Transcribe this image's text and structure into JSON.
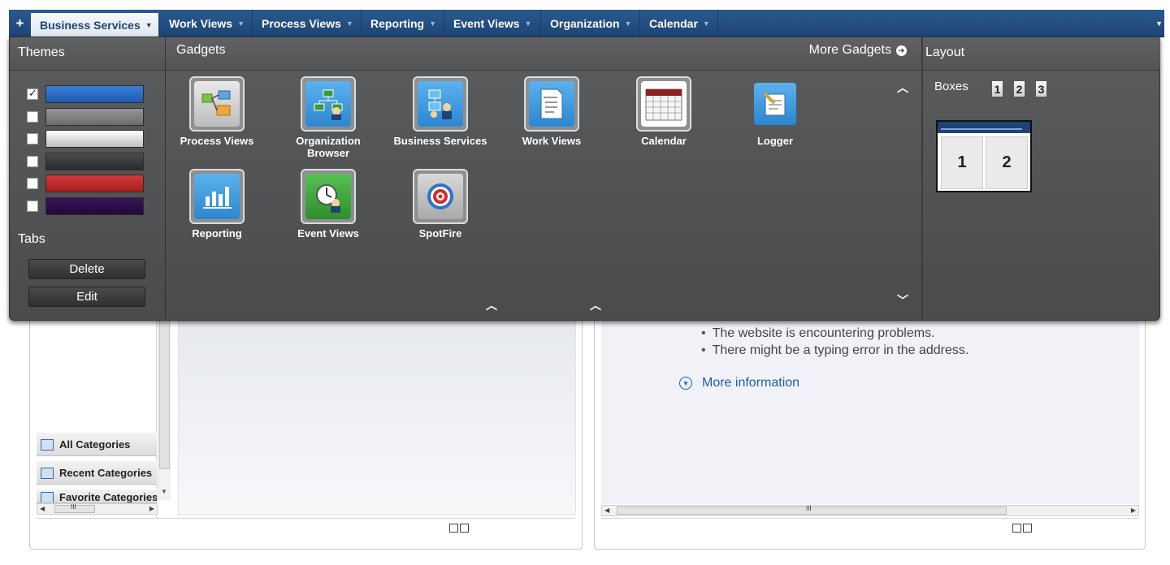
{
  "tabbar": {
    "add_label": "+",
    "tabs": [
      {
        "label": "Business Services"
      },
      {
        "label": "Work Views"
      },
      {
        "label": "Process Views"
      },
      {
        "label": "Reporting"
      },
      {
        "label": "Event Views"
      },
      {
        "label": "Organization"
      },
      {
        "label": "Calendar"
      }
    ],
    "active_tab": "Business Services"
  },
  "themes": {
    "title": "Themes",
    "swatches": [
      {
        "color": "#1f5bb0",
        "checked": true
      },
      {
        "color": "#7b7c7e",
        "checked": false
      },
      {
        "color": "#cfcfcf",
        "checked": false
      },
      {
        "color": "#3a3b3c",
        "checked": false
      },
      {
        "color": "#b42222",
        "checked": false
      },
      {
        "color": "#2a0b3f",
        "checked": false
      }
    ],
    "tabs_label": "Tabs",
    "delete_label": "Delete",
    "edit_label": "Edit"
  },
  "gadgets": {
    "title": "Gadgets",
    "more_label": "More Gadgets",
    "items": [
      {
        "label": "Process Views",
        "icon": "process-views-icon"
      },
      {
        "label": "Organization Browser",
        "icon": "org-browser-icon"
      },
      {
        "label": "Business Services",
        "icon": "business-services-icon"
      },
      {
        "label": "Work Views",
        "icon": "work-views-icon"
      },
      {
        "label": "Calendar",
        "icon": "calendar-icon"
      },
      {
        "label": "Logger",
        "icon": "logger-icon"
      },
      {
        "label": "Reporting",
        "icon": "reporting-icon"
      },
      {
        "label": "Event Views",
        "icon": "event-views-icon"
      },
      {
        "label": "SpotFire",
        "icon": "spotfire-icon"
      }
    ]
  },
  "layout": {
    "title": "Layout",
    "boxes_label": "Boxes",
    "box_options": [
      "1",
      "2",
      "3"
    ],
    "selected_boxes": "2",
    "preview_panes": [
      "1",
      "2"
    ]
  },
  "background": {
    "categories": [
      "All Categories",
      "Recent Categories",
      "Favorite Categories"
    ],
    "error_bullets": [
      "The website is encountering problems.",
      "There might be a typing error in the address."
    ],
    "more_info": "More information",
    "scroll_mark": "III"
  }
}
